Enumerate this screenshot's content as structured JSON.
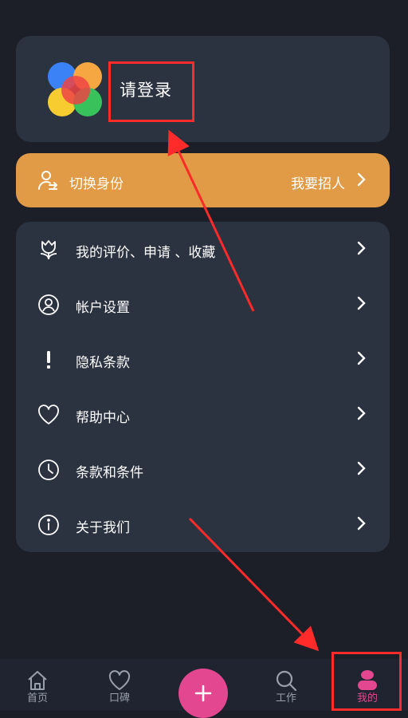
{
  "profile": {
    "login_text": "请登录",
    "logo_icon": "app-logo-icon"
  },
  "switch_identity": {
    "label": "切换身份",
    "action": "我要招人",
    "icon": "user-switch-icon",
    "color": "#e19a45"
  },
  "menu": {
    "items": [
      {
        "label": "我的评价、申请 、收藏",
        "icon": "tulip-icon"
      },
      {
        "label": "帐户设置",
        "icon": "account-circle-icon"
      },
      {
        "label": "隐私条款",
        "icon": "exclamation-icon"
      },
      {
        "label": "帮助中心",
        "icon": "heart-icon"
      },
      {
        "label": "条款和条件",
        "icon": "clock-icon"
      },
      {
        "label": "关于我们",
        "icon": "info-icon"
      }
    ]
  },
  "tabbar": {
    "home": "首页",
    "reputation": "口碑",
    "add": "+",
    "work": "工作",
    "mine": "我的",
    "active_color": "#e2478f"
  },
  "annotation_color": "#ff2a2a"
}
